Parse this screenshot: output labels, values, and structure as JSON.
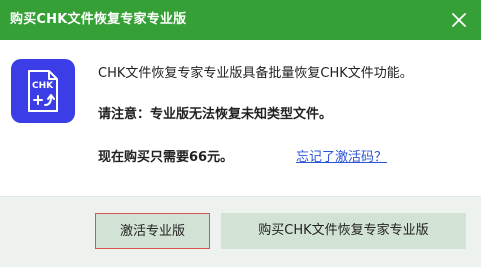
{
  "window": {
    "title": "购买CHK文件恢复专家专业版",
    "close_icon": "close-icon"
  },
  "colors": {
    "titlebar": "#35a035",
    "icon_bg": "#3b3ee6",
    "link": "#2a55d6",
    "button_bg": "#d2e3d5",
    "button_highlight_border": "#d9534f"
  },
  "app_icon": {
    "label": "CHK",
    "icon": "chk-file-recovery-icon"
  },
  "message": {
    "line1": "CHK文件恢复专家专业版具备批量恢复CHK文件功能。",
    "line2": "请注意：专业版无法恢复未知类型文件。",
    "line3": "现在购买只需要66元。",
    "forgot_link": "忘记了激活码？"
  },
  "buttons": {
    "activate_label": "激活专业版",
    "buy_label": "购买CHK文件恢复专家专业版"
  }
}
